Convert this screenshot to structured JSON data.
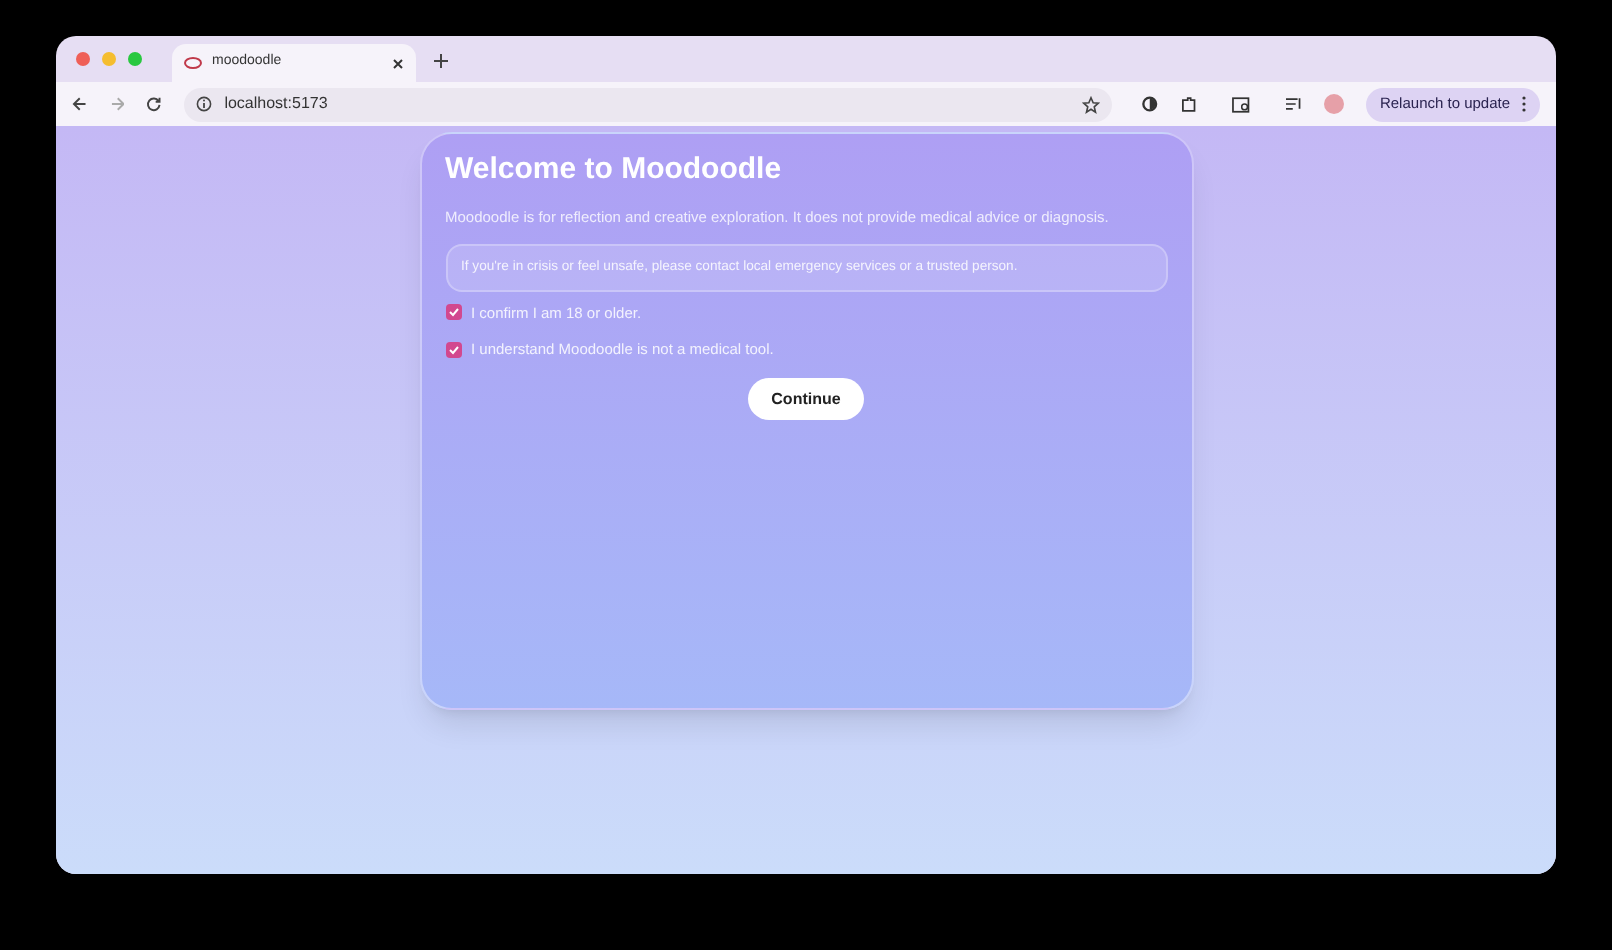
{
  "browser": {
    "tab": {
      "title": "moodoodle",
      "selected": true
    },
    "address": "localhost:5173",
    "relaunch_button": "Relaunch to update"
  },
  "dialog": {
    "title": "Welcome to Moodoodle",
    "description": "Moodoodle is for reflection and creative exploration. It does not provide medical advice or diagnosis.",
    "notice": "If you're in crisis or feel unsafe, please contact local emergency services or a trusted person.",
    "checkboxes": [
      {
        "label": "I confirm I am 18 or older.",
        "checked": true
      },
      {
        "label": "I understand Moodoodle is not a medical tool.",
        "checked": true
      }
    ],
    "continue_button": "Continue"
  }
}
